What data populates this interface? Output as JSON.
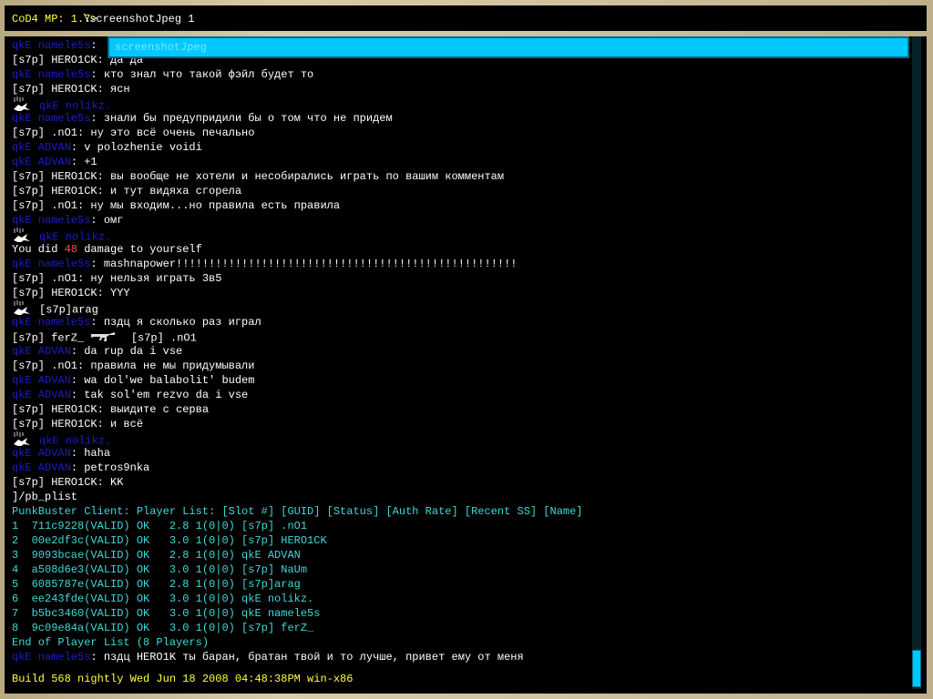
{
  "console": {
    "prompt": "CoD4 MP: 1.7>",
    "command": "\\screenshotJpeg 1",
    "autocomplete": "screenshotJpeg",
    "build": "Build 568 nightly Wed Jun 18 2008 04:48:38PM win-x86"
  },
  "lines": [
    [
      [
        "b",
        "qkE namele5s"
      ],
      [
        "w",
        ":"
      ]
    ],
    [
      [
        "w",
        "[s7p] HERO1CK: да да"
      ]
    ],
    [
      [
        "b",
        "qkE namele5s"
      ],
      [
        "w",
        ": кто знал что такой фэйл будет то"
      ]
    ],
    [
      [
        "w",
        "[s7p] HERO1CK: ясн"
      ]
    ],
    [
      [
        "i",
        "suicide-icon"
      ],
      [
        "b",
        "qkE nolikz."
      ]
    ],
    [
      [
        "b",
        "qkE namele5s"
      ],
      [
        "w",
        ": знали бы предупридили бы о том что не придем"
      ]
    ],
    [
      [
        "w",
        "[s7p] .nO1: ну это всё очень печально"
      ]
    ],
    [
      [
        "b",
        "qkE ADVAN"
      ],
      [
        "w",
        ": v polozhenie voidi"
      ]
    ],
    [
      [
        "b",
        "qkE ADVAN"
      ],
      [
        "w",
        ": +1"
      ]
    ],
    [
      [
        "w",
        "[s7p] HERO1CK: вы вообще не хотели и несобирались играть по вашим комментам"
      ]
    ],
    [
      [
        "w",
        "[s7p] HERO1CK: и тут видяха сгорела"
      ]
    ],
    [
      [
        "w",
        "[s7p] .nO1: ну мы входим...но правила есть правила"
      ]
    ],
    [
      [
        "b",
        "qkE namele5s"
      ],
      [
        "w",
        ": омг"
      ]
    ],
    [
      [
        "i",
        "suicide-icon"
      ],
      [
        "b",
        "qkE nolikz."
      ]
    ],
    [
      [
        "w",
        "You did "
      ],
      [
        "r",
        "48"
      ],
      [
        "w",
        " damage to yourself"
      ]
    ],
    [
      [
        "b",
        "qkE namele5s"
      ],
      [
        "w",
        ": mashnapower!!!!!!!!!!!!!!!!!!!!!!!!!!!!!!!!!!!!!!!!!!!!!!!!!!!!"
      ]
    ],
    [
      [
        "w",
        "[s7p] .nO1: ну нельзя играть 3в5"
      ]
    ],
    [
      [
        "w",
        "[s7p] HERO1CK: YYY"
      ]
    ],
    [
      [
        "i",
        "suicide-icon"
      ],
      [
        "w",
        "[s7p]arag"
      ]
    ],
    [
      [
        "b",
        "qkE namele5s"
      ],
      [
        "w",
        ": пздц я сколько раз играл"
      ]
    ],
    [
      [
        "w",
        "[s7p] ferZ_ "
      ],
      [
        "i",
        "rifle-icon"
      ],
      [
        "w",
        "  [s7p] .nO1"
      ]
    ],
    [
      [
        "b",
        "qkE ADVAN"
      ],
      [
        "w",
        ": da rup da i vse"
      ]
    ],
    [
      [
        "w",
        "[s7p] .nO1: правила не мы придумывали"
      ]
    ],
    [
      [
        "b",
        "qkE ADVAN"
      ],
      [
        "w",
        ": wa dol'we balabolit' budem"
      ]
    ],
    [
      [
        "b",
        "qkE ADVAN"
      ],
      [
        "w",
        ": tak sol'em rezvo da i vse"
      ]
    ],
    [
      [
        "w",
        "[s7p] HERO1CK: выидите с серва"
      ]
    ],
    [
      [
        "w",
        "[s7p] HERO1CK: и всё"
      ]
    ],
    [
      [
        "i",
        "suicide-icon"
      ],
      [
        "b",
        "qkE nolikz."
      ]
    ],
    [
      [
        "b",
        "qkE ADVAN"
      ],
      [
        "w",
        ": haha"
      ]
    ],
    [
      [
        "b",
        "qkE ADVAN"
      ],
      [
        "w",
        ": petros9nka"
      ]
    ],
    [
      [
        "w",
        "[s7p] HERO1CK: KK"
      ]
    ],
    [
      [
        "w",
        "]/pb_plist"
      ]
    ],
    [
      [
        "c",
        "PunkBuster Client: Player List: [Slot #] [GUID] [Status] [Auth Rate] [Recent SS] [Name]"
      ]
    ],
    [
      [
        "c",
        "1  711c9228(VALID) OK   2.8 1(0|0) [s7p] .nO1"
      ]
    ],
    [
      [
        "c",
        "2  00e2df3c(VALID) OK   3.0 1(0|0) [s7p] HERO1CK"
      ]
    ],
    [
      [
        "c",
        "3  9093bcae(VALID) OK   2.8 1(0|0) qkE ADVAN"
      ]
    ],
    [
      [
        "c",
        "4  a508d6e3(VALID) OK   3.0 1(0|0) [s7p] NaUm"
      ]
    ],
    [
      [
        "c",
        "5  6085787e(VALID) OK   2.8 1(0|0) [s7p]arag"
      ]
    ],
    [
      [
        "c",
        "6  ee243fde(VALID) OK   3.0 1(0|0) qkE nolikz."
      ]
    ],
    [
      [
        "c",
        "7  b5bc3460(VALID) OK   3.0 1(0|0) qkE namele5s"
      ]
    ],
    [
      [
        "c",
        "8  9c09e84a(VALID) OK   3.0 1(0|0) [s7p] ferZ_"
      ]
    ],
    [
      [
        "c",
        "End of Player List (8 Players)"
      ]
    ],
    [
      [
        "b",
        "qkE namele5s"
      ],
      [
        "w",
        ": пздц HERO1K ты баран, братан твой и то лучше, привет ему от меня"
      ]
    ]
  ],
  "scrollbar": {
    "position_percent": 100
  }
}
